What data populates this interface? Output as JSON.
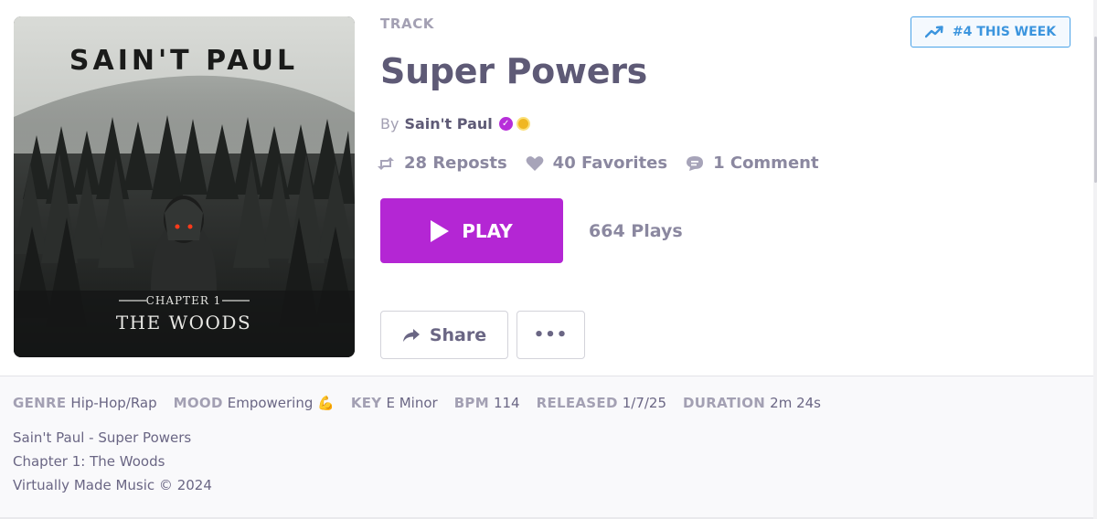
{
  "artwork": {
    "artist_text": "SAIN'T PAUL",
    "chapter_text": "CHAPTER 1",
    "subtitle_text": "THE WOODS"
  },
  "track": {
    "type_label": "TRACK",
    "title": "Super Powers",
    "by_label": "By",
    "artist": "Sain't Paul"
  },
  "stats": {
    "reposts": "28 Reposts",
    "favorites": "40 Favorites",
    "comments": "1 Comment"
  },
  "actions": {
    "play_label": "PLAY",
    "plays_count": "664 Plays",
    "share_label": "Share",
    "more_label": "•••"
  },
  "trending": {
    "label": "#4 THIS WEEK"
  },
  "metadata": [
    {
      "key": "GENRE",
      "value": "Hip-Hop/Rap"
    },
    {
      "key": "MOOD",
      "value": "Empowering 💪"
    },
    {
      "key": "KEY",
      "value": "E Minor"
    },
    {
      "key": "BPM",
      "value": "114"
    },
    {
      "key": "RELEASED",
      "value": "1/7/25"
    },
    {
      "key": "DURATION",
      "value": "2m 24s"
    }
  ],
  "description": [
    "Sain't Paul - Super Powers",
    "Chapter 1: The Woods",
    "Virtually Made Music © 2024"
  ],
  "colors": {
    "accent": "#b426d4",
    "trend": "#3c95de",
    "title": "#5e5a76"
  }
}
